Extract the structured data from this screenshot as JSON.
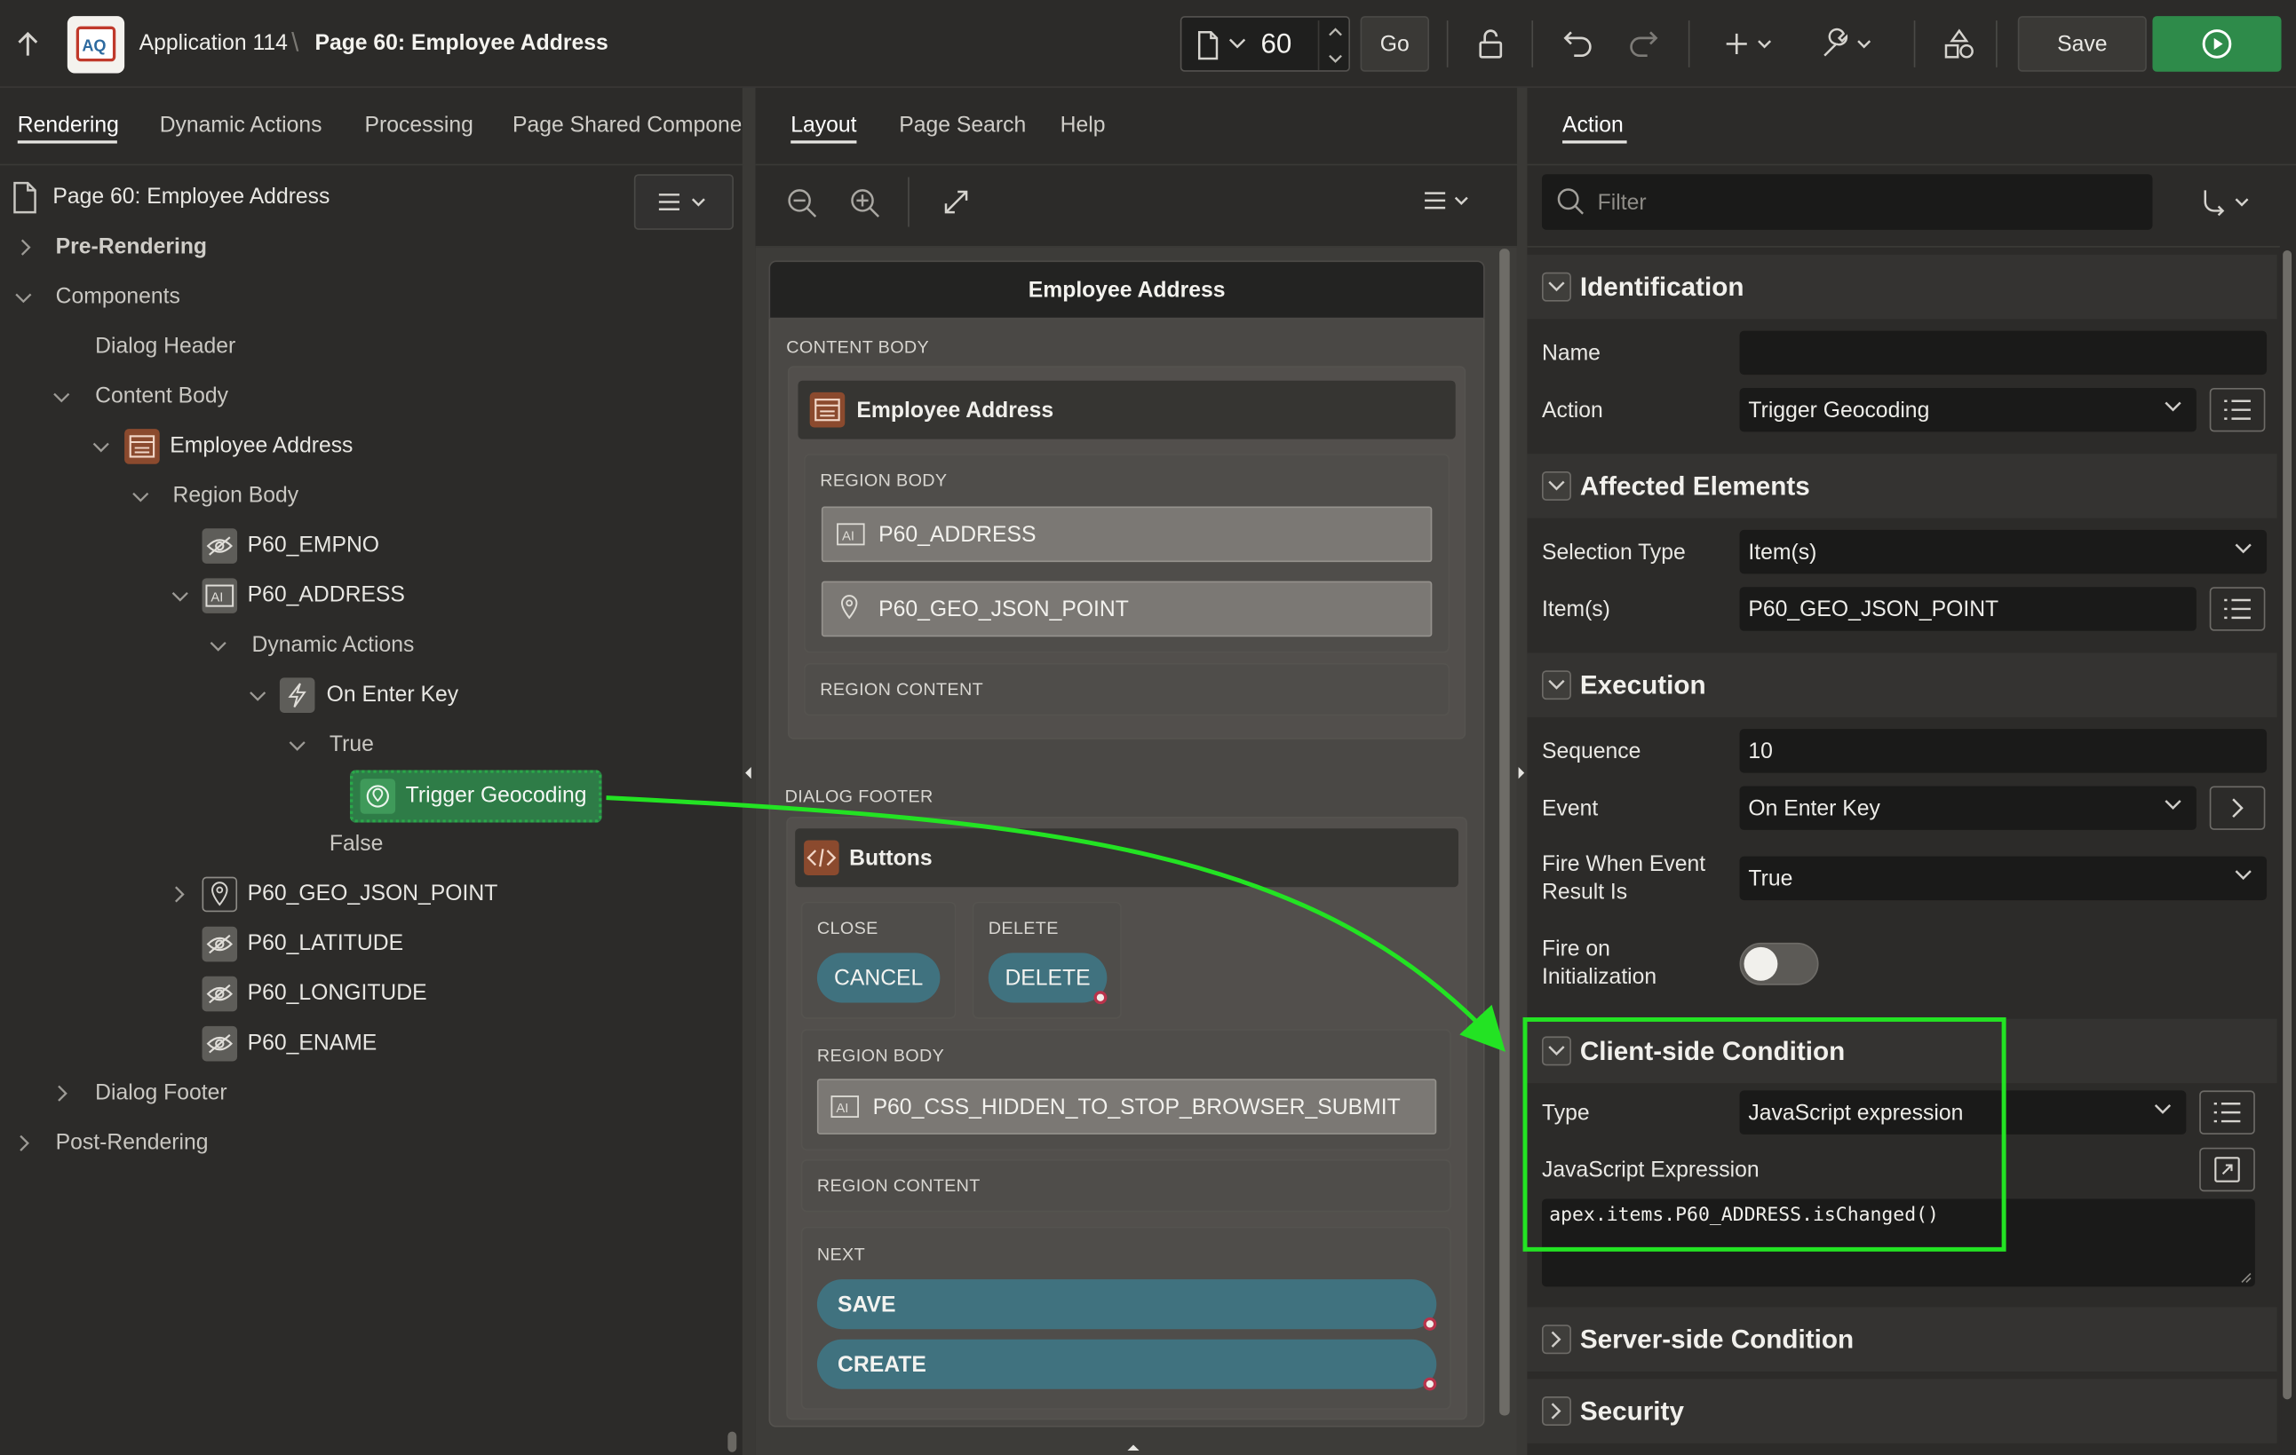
{
  "header": {
    "app_name": "Application 114",
    "separator": "\\",
    "page_title": "Page 60: Employee Address",
    "page_number": "60",
    "go_label": "Go",
    "save_label": "Save"
  },
  "left": {
    "tabs": [
      "Rendering",
      "Dynamic Actions",
      "Processing",
      "Page Shared Componer"
    ],
    "tree": {
      "root": "Page 60: Employee Address",
      "pre_rendering": "Pre-Rendering",
      "components": "Components",
      "dialog_header": "Dialog Header",
      "content_body": "Content Body",
      "employee_address": "Employee Address",
      "region_body": "Region Body",
      "empno": "P60_EMPNO",
      "address": "P60_ADDRESS",
      "dynamic_actions": "Dynamic Actions",
      "on_enter_key": "On Enter Key",
      "true_branch": "True",
      "trigger_geocoding": "Trigger Geocoding",
      "false_branch": "False",
      "geo_json_point": "P60_GEO_JSON_POINT",
      "latitude": "P60_LATITUDE",
      "longitude": "P60_LONGITUDE",
      "ename": "P60_ENAME",
      "dialog_footer": "Dialog Footer",
      "post_rendering": "Post-Rendering"
    }
  },
  "middle": {
    "tabs": [
      "Layout",
      "Page Search",
      "Help"
    ],
    "dialog_title": "Employee Address",
    "content_body_label": "CONTENT BODY",
    "region_title": "Employee Address",
    "region_body_label": "REGION BODY",
    "address_item": "P60_ADDRESS",
    "geo_item": "P60_GEO_JSON_POINT",
    "region_content_label": "REGION CONTENT",
    "dialog_footer_label": "DIALOG FOOTER",
    "buttons_title": "Buttons",
    "close_label": "CLOSE",
    "cancel_button": "CANCEL",
    "delete_label": "DELETE",
    "delete_button": "DELETE",
    "region_body_label_2": "REGION BODY",
    "hidden_item": "P60_CSS_HIDDEN_TO_STOP_BROWSER_SUBMIT",
    "region_content_label_2": "REGION CONTENT",
    "next_label": "NEXT",
    "save_button": "SAVE",
    "create_button": "CREATE"
  },
  "right": {
    "tab": "Action",
    "filter_placeholder": "Filter",
    "identification": {
      "title": "Identification",
      "name_label": "Name",
      "name_value": "",
      "action_label": "Action",
      "action_value": "Trigger Geocoding"
    },
    "affected": {
      "title": "Affected Elements",
      "selection_type_label": "Selection Type",
      "selection_type_value": "Item(s)",
      "items_label": "Item(s)",
      "items_value": "P60_GEO_JSON_POINT"
    },
    "execution": {
      "title": "Execution",
      "sequence_label": "Sequence",
      "sequence_value": "10",
      "event_label": "Event",
      "event_value": "On Enter Key",
      "fire_when_label_1": "Fire When Event",
      "fire_when_label_2": "Result Is",
      "fire_when_value": "True",
      "fire_init_label_1": "Fire on",
      "fire_init_label_2": "Initialization"
    },
    "client_condition": {
      "title": "Client-side Condition",
      "type_label": "Type",
      "type_value": "JavaScript expression",
      "expr_label": "JavaScript Expression",
      "expr_value": "apex.items.P60_ADDRESS.isChanged()"
    },
    "server_condition_title": "Server-side Condition",
    "security_title": "Security"
  },
  "colors": {
    "accent_green": "#23e323",
    "run_button": "#2e8b4a",
    "pill_teal": "#40727f",
    "region_icon": "#8b4a2e"
  },
  "icons": [
    "up-arrow-icon",
    "app-logo-icon",
    "page-icon",
    "lock-icon",
    "undo-icon",
    "redo-icon",
    "plus-icon",
    "wrench-icon",
    "shared-components-icon",
    "run-icon",
    "menu-icon",
    "zoom-out-icon",
    "zoom-in-icon",
    "expand-icon",
    "search-icon",
    "sort-icon",
    "hidden-item-icon",
    "text-item-icon",
    "region-icon",
    "lightning-icon",
    "geocode-icon",
    "map-pin-icon",
    "code-icon",
    "list-icon",
    "external-link-icon",
    "chevron-down-icon",
    "chevron-right-icon"
  ]
}
